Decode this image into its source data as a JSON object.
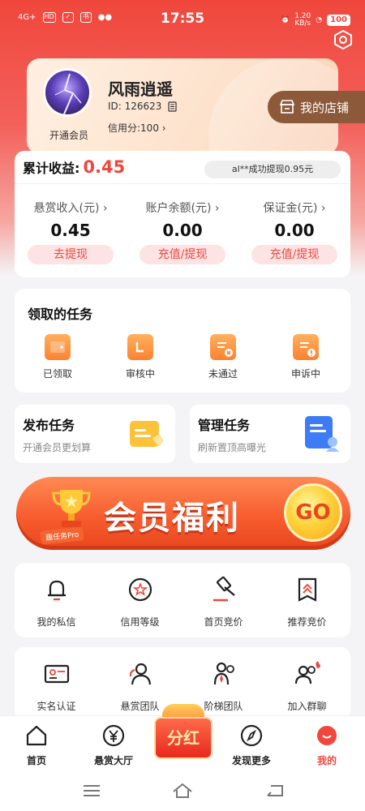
{
  "status_bar": {
    "network": "4G+",
    "chip_hd": "HD",
    "time": "17:55",
    "speed_value": "1.20",
    "speed_unit": "KB/s",
    "battery": "100"
  },
  "profile": {
    "nickname": "风雨逍遥",
    "id_text": "ID: 126623",
    "credit_text": "信用分:100 ›",
    "vip_link": "开通会员",
    "my_shop_label": "我的店铺"
  },
  "earnings": {
    "title": "累计收益:",
    "total": "0.45",
    "notice": "al**成功提现0.95元",
    "columns": [
      {
        "label": "悬赏收入(元) ›",
        "value": "0.45",
        "action": "去提现"
      },
      {
        "label": "账户余额(元) ›",
        "value": "0.00",
        "action": "充值/提现"
      },
      {
        "label": "保证金(元) ›",
        "value": "0.00",
        "action": "充值/提现"
      }
    ]
  },
  "tasks": {
    "title": "领取的任务",
    "items": [
      {
        "label": "已领取",
        "icon": "wallet-icon"
      },
      {
        "label": "审核中",
        "icon": "review-icon"
      },
      {
        "label": "未通过",
        "icon": "rejected-icon"
      },
      {
        "label": "申诉中",
        "icon": "appeal-icon"
      }
    ]
  },
  "publish": {
    "title": "发布任务",
    "subtitle": "开通会员更划算"
  },
  "manage": {
    "title": "管理任务",
    "subtitle": "刷新置顶高曝光"
  },
  "banner": {
    "text": "会员福利",
    "tag": "趣任务Pro",
    "go": "GO"
  },
  "tools_row1": [
    {
      "label": "我的私信",
      "icon": "bell-icon"
    },
    {
      "label": "信用等级",
      "icon": "credit-star-icon"
    },
    {
      "label": "首页竞价",
      "icon": "gavel-icon"
    },
    {
      "label": "推荐竞价",
      "icon": "recommend-icon"
    }
  ],
  "tools_row2": [
    {
      "label": "实名认证",
      "icon": "id-card-icon"
    },
    {
      "label": "悬赏团队",
      "icon": "team-icon"
    },
    {
      "label": "阶梯团队",
      "icon": "ladder-team-icon"
    },
    {
      "label": "加入群聊",
      "icon": "group-chat-icon"
    }
  ],
  "tabbar": {
    "items": [
      {
        "label": "首页",
        "icon": "home-icon"
      },
      {
        "label": "悬赏大厅",
        "icon": "yuan-icon"
      },
      {
        "label": "分红",
        "icon": "dividend-icon"
      },
      {
        "label": "发现更多",
        "icon": "compass-icon"
      },
      {
        "label": "我的",
        "icon": "profile-icon"
      }
    ],
    "active": "我的"
  },
  "colors": {
    "accent": "#f0473c",
    "shop_button": "#8c5a3a",
    "task_orange": "#fb8230"
  }
}
